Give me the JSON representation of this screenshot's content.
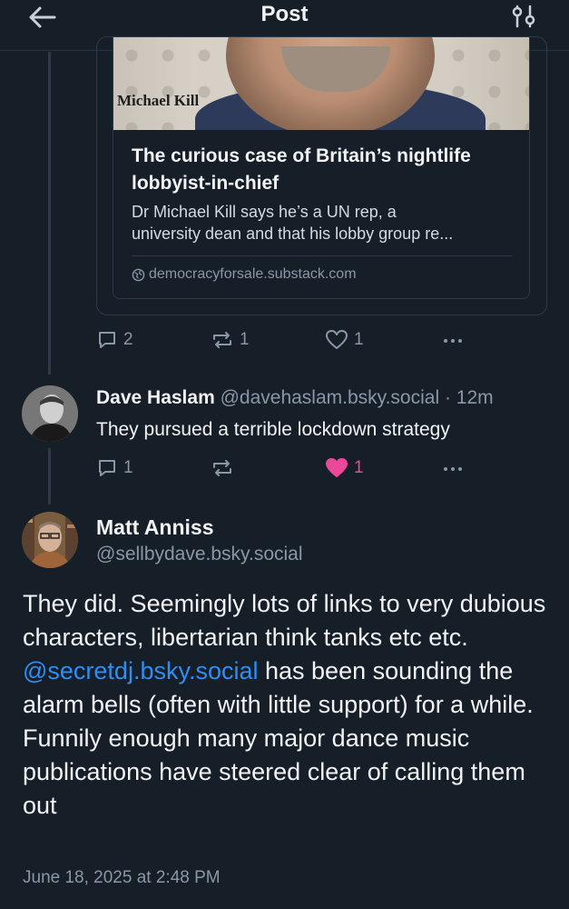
{
  "header": {
    "title": "Post",
    "back_icon": "arrow-left-icon",
    "settings_icon": "sliders-icon"
  },
  "link_card": {
    "image_caption": "Michael Kill",
    "title_line1": "The curious case of Britain’s nightlife",
    "title_line2": "lobbyist-in-chief",
    "desc_line1": "Dr Michael Kill says he’s a UN rep, a",
    "desc_line2": "university dean and that his lobby group re...",
    "domain": "democracyforsale.substack.com"
  },
  "quoted_post_actions": {
    "replies": "2",
    "reposts": "1",
    "likes": "1",
    "liked": false
  },
  "reply": {
    "name": "Dave Haslam",
    "handle": "@davehaslam.bsky.social",
    "time": "· 12m",
    "text": "They pursued a terrible lockdown strategy",
    "replies": "1",
    "reposts": "",
    "likes": "1",
    "liked": true,
    "like_color": "#ec4899"
  },
  "main_post": {
    "name": "Matt Anniss",
    "handle": "@sellbydave.bsky.social",
    "text_before": "They did. Seemingly lots of links to very dubious characters, libertarian think tanks etc etc. ",
    "mention": "@secretdj.bsky.social",
    "text_after": " has been sounding the alarm bells (often with little support) for a while. Funnily enough many major dance music publications have steered clear of calling them out",
    "timestamp": "June 18, 2025 at 2:48 PM"
  },
  "colors": {
    "background": "#161e27",
    "accent": "#2f8ef4",
    "muted": "#8b97a6"
  }
}
